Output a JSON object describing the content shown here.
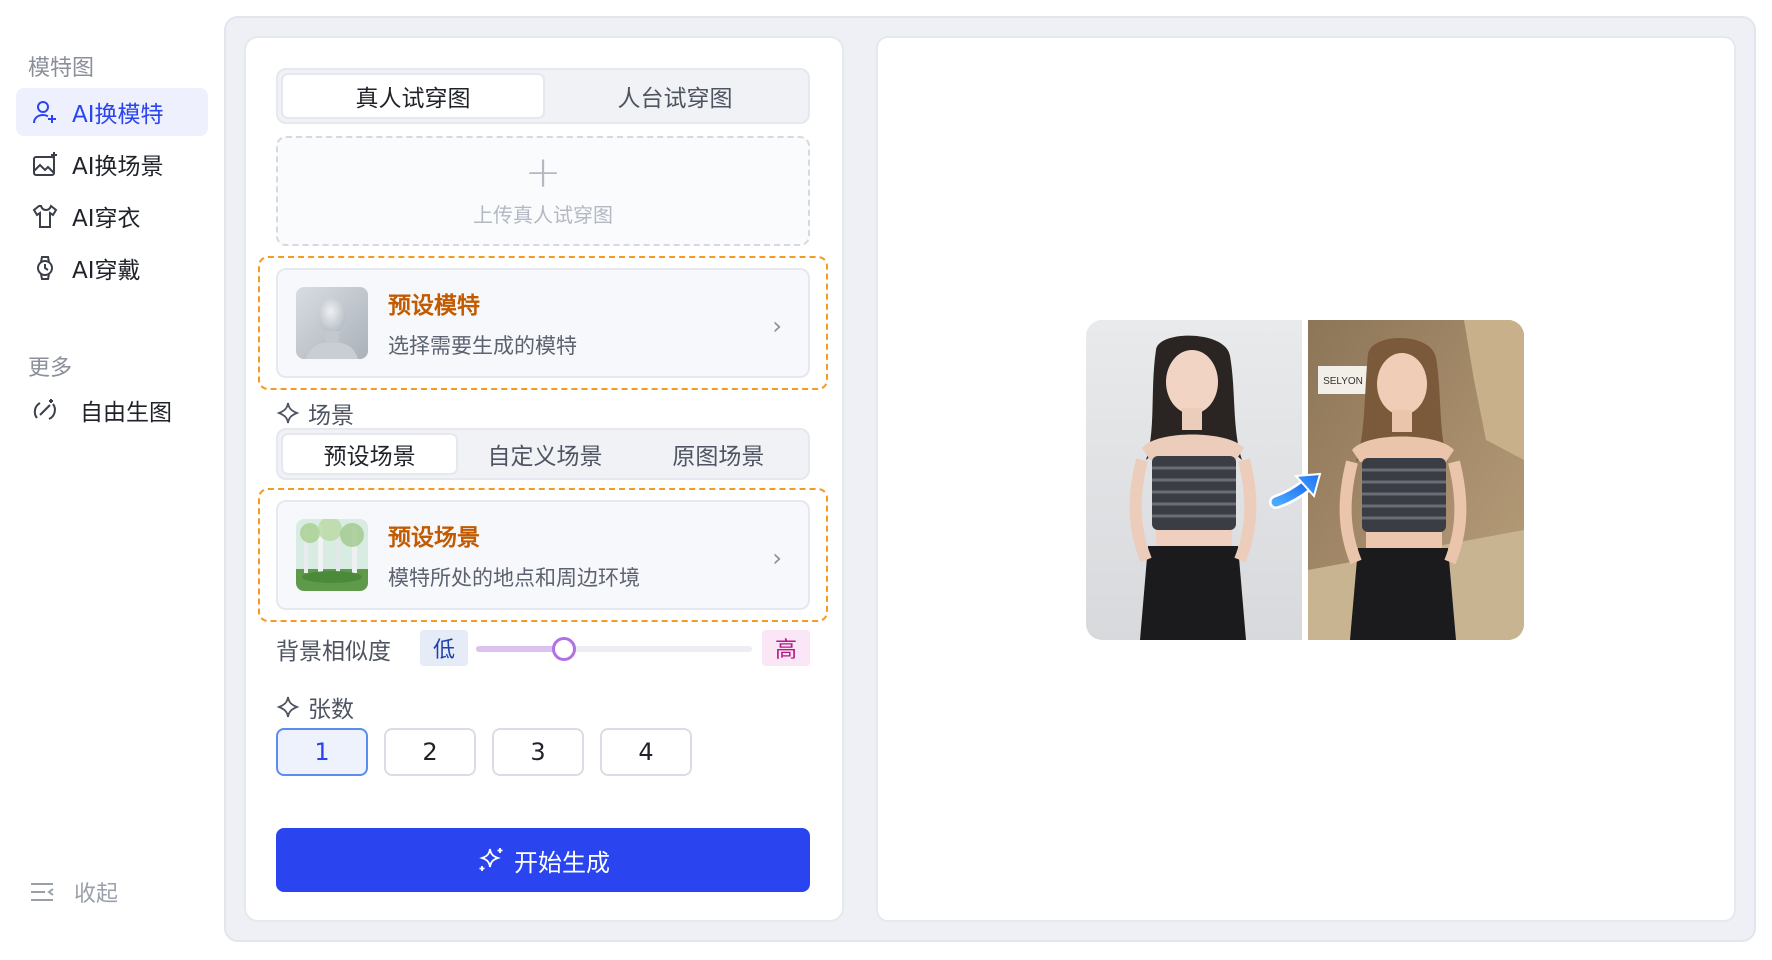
{
  "sidebar": {
    "section1_title": "模特图",
    "items": [
      {
        "label": "AI换模特",
        "icon": "user-plus-icon",
        "active": true
      },
      {
        "label": "AI换场景",
        "icon": "image-sparkle-icon",
        "active": false
      },
      {
        "label": "AI穿衣",
        "icon": "shirt-icon",
        "active": false
      },
      {
        "label": "AI穿戴",
        "icon": "watch-icon",
        "active": false
      }
    ],
    "section2_title": "更多",
    "more_items": [
      {
        "label": "自由生图",
        "icon": "magic-brush-icon"
      }
    ],
    "collapse_label": "收起"
  },
  "panel": {
    "tryon_tabs": [
      "真人试穿图",
      "人台试穿图"
    ],
    "tryon_selected": 0,
    "upload_label": "上传真人试穿图",
    "model_card": {
      "title": "预设模特",
      "desc": "选择需要生成的模特"
    },
    "scene_label": "场景",
    "scene_tabs": [
      "预设场景",
      "自定义场景",
      "原图场景"
    ],
    "scene_selected": 0,
    "scene_card": {
      "title": "预设场景",
      "desc": "模特所处的地点和周边环境"
    },
    "similarity": {
      "label": "背景相似度",
      "low": "低",
      "high": "高",
      "value": 0.32
    },
    "count_label": "张数",
    "counts": [
      "1",
      "2",
      "3",
      "4"
    ],
    "count_selected": 0,
    "generate_label": "开始生成"
  },
  "preview": {
    "sign_text": "SELYON"
  },
  "colors": {
    "accent": "#2a45f0",
    "highlight_border": "#f59a23",
    "card_title": "#c25a00"
  }
}
